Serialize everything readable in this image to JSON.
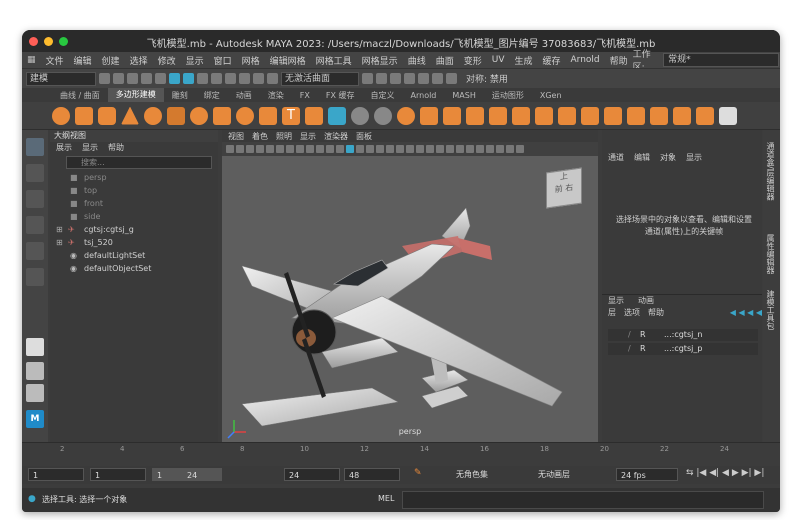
{
  "window": {
    "title": "飞机模型.mb - Autodesk MAYA 2023: /Users/maczl/Downloads/飞机模型_图片编号 37083683/飞机模型.mb",
    "traffic_colors": [
      "#ff5f57",
      "#febc2e",
      "#28c840"
    ]
  },
  "menubar": {
    "items": [
      "文件",
      "编辑",
      "创建",
      "选择",
      "修改",
      "显示",
      "窗口",
      "网格",
      "编辑网格",
      "网格工具",
      "网格显示",
      "曲线",
      "曲面",
      "变形",
      "UV",
      "生成",
      "缓存",
      "Arnold",
      "帮助"
    ],
    "workspace_label": "工作区:",
    "workspace_value": "常规*"
  },
  "statusline": {
    "mode": "建模",
    "live_surface": "无激活曲面",
    "symmetry_label": "对称: 禁用"
  },
  "shelf": {
    "tabs": [
      "曲线 / 曲面",
      "多边形建模",
      "雕刻",
      "绑定",
      "动画",
      "渲染",
      "FX",
      "FX 缓存",
      "自定义",
      "Arnold",
      "MASH",
      "运动图形",
      "XGen"
    ],
    "active_index": 1
  },
  "outliner": {
    "title": "大纲视图",
    "menu": [
      "展示",
      "显示",
      "帮助"
    ],
    "search_placeholder": "搜索...",
    "items": [
      {
        "label": "persp",
        "dim": true
      },
      {
        "label": "top",
        "dim": true
      },
      {
        "label": "front",
        "dim": true
      },
      {
        "label": "side",
        "dim": true
      },
      {
        "label": "cgtsj:cgtsj_g",
        "dim": false
      },
      {
        "label": "tsj_520",
        "dim": false
      },
      {
        "label": "defaultLightSet",
        "dim": false
      },
      {
        "label": "defaultObjectSet",
        "dim": false
      }
    ]
  },
  "viewport": {
    "menu": [
      "视图",
      "着色",
      "照明",
      "显示",
      "渲染器",
      "面板"
    ],
    "camera_label": "persp",
    "viewcube": {
      "top": "上",
      "front": "前",
      "right": "右"
    }
  },
  "attribute_editor": {
    "menu": [
      "通道",
      "编辑",
      "对象",
      "显示"
    ],
    "message": "选择场景中的对象以查看、编辑和设置通道(属性)上的关键帧"
  },
  "layer_editor": {
    "tabs": [
      "显示",
      "动画"
    ],
    "menu": [
      "层",
      "选项",
      "帮助"
    ],
    "rows": [
      {
        "flag": "R",
        "name": "...:cgtsj_n"
      },
      {
        "flag": "R",
        "name": "...:cgtsj_p"
      }
    ]
  },
  "side_tabs": [
    "通道盒/层编辑器",
    "属性编辑器",
    "建模工具包"
  ],
  "timeline": {
    "ticks": [
      "2",
      "4",
      "6",
      "8",
      "10",
      "12",
      "14",
      "16",
      "18",
      "20",
      "22",
      "24"
    ]
  },
  "range": {
    "start": "1",
    "current": "1",
    "range_start": "1",
    "range_end": "24",
    "end": "24",
    "anim_end": "48",
    "char_set": "无角色集",
    "anim_layer": "无动画层",
    "fps": "24 fps"
  },
  "command_line": {
    "help": "选择工具: 选择一个对象",
    "lang": "MEL"
  },
  "colors": {
    "accent_orange": "#e8893a",
    "teal": "#3aa6c9",
    "model_wing_tip": "#c86f6a",
    "model_body": "#c9c9c9"
  }
}
